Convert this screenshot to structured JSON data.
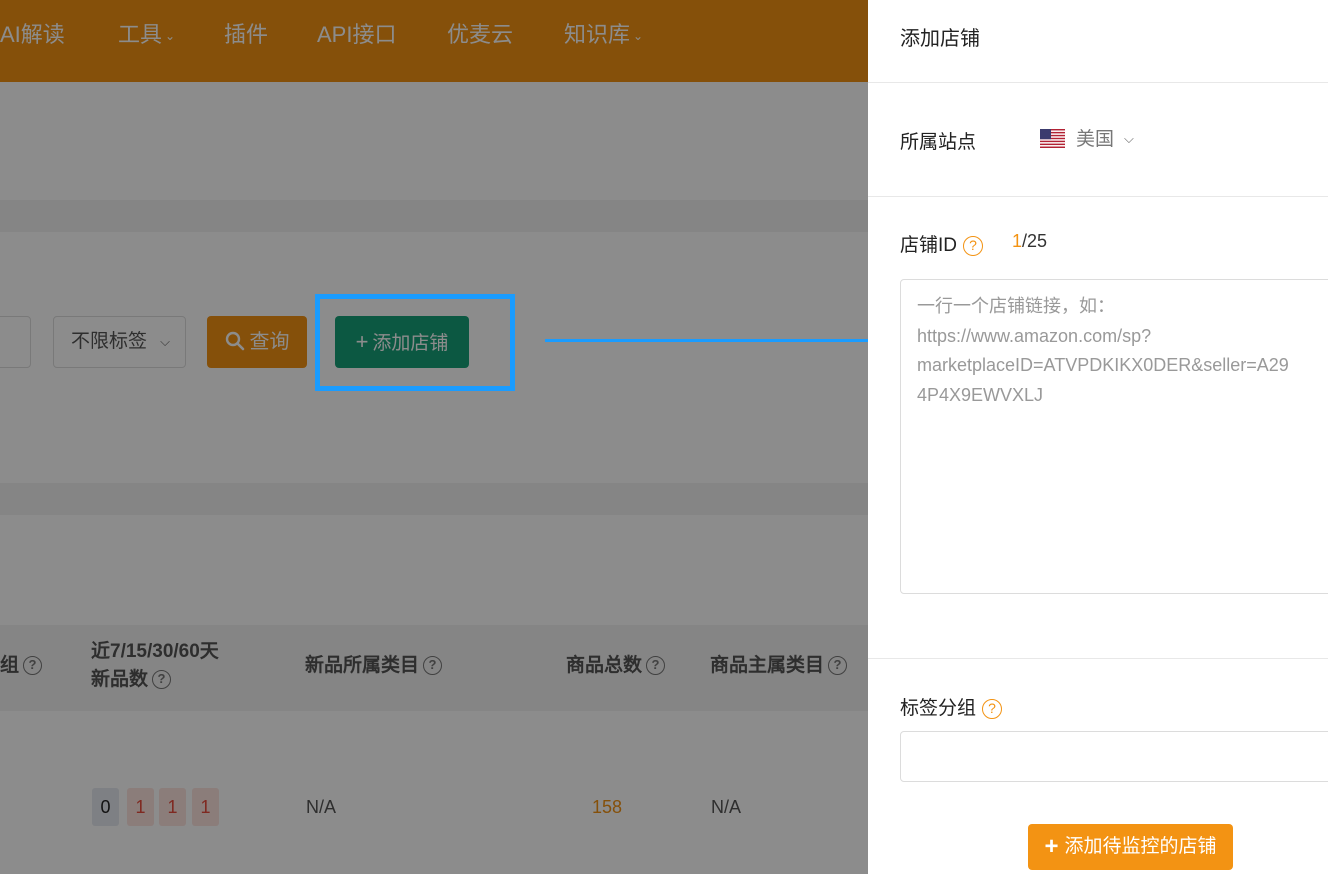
{
  "nav": {
    "items": [
      {
        "label": "AI解读",
        "dropdown": false
      },
      {
        "label": "工具",
        "dropdown": true
      },
      {
        "label": "插件",
        "dropdown": false
      },
      {
        "label": "API接口",
        "dropdown": false
      },
      {
        "label": "优麦云",
        "dropdown": false
      },
      {
        "label": "知识库",
        "dropdown": true
      }
    ],
    "caret": "⌄"
  },
  "filters": {
    "tag_select_value": "不限标签",
    "query_label": "查询",
    "add_store_label": "添加店铺",
    "plus": "+"
  },
  "table": {
    "headers": {
      "group": "组",
      "new_items": "近7/15/30/60天",
      "new_items_line2": "新品数",
      "new_category": "新品所属类目",
      "total_items": "商品总数",
      "main_category": "商品主属类目"
    },
    "help_glyph": "?",
    "row": {
      "new_counts": [
        "0",
        "1",
        "1",
        "1"
      ],
      "new_category": "N/A",
      "total_items": "158",
      "main_category": "N/A"
    }
  },
  "drawer": {
    "title": "添加店铺",
    "site_label": "所属站点",
    "site_value": "美国",
    "store_id_label": "店铺ID",
    "counter_current": "1",
    "counter_sep_total": "/25",
    "textarea_placeholder": "一行一个店铺链接，如：\nhttps://www.amazon.com/sp?\nmarketplaceID=ATVPDKIKX0DER&seller=A29\n4P4X9EWVXLJ",
    "tag_group_label": "标签分组",
    "tag_input_value": "",
    "submit_label": "添加待监控的店铺",
    "submit_plus": "+"
  },
  "colors": {
    "brand_orange": "#f39313",
    "green": "#16a179",
    "annotation_blue": "#1a9cff"
  }
}
